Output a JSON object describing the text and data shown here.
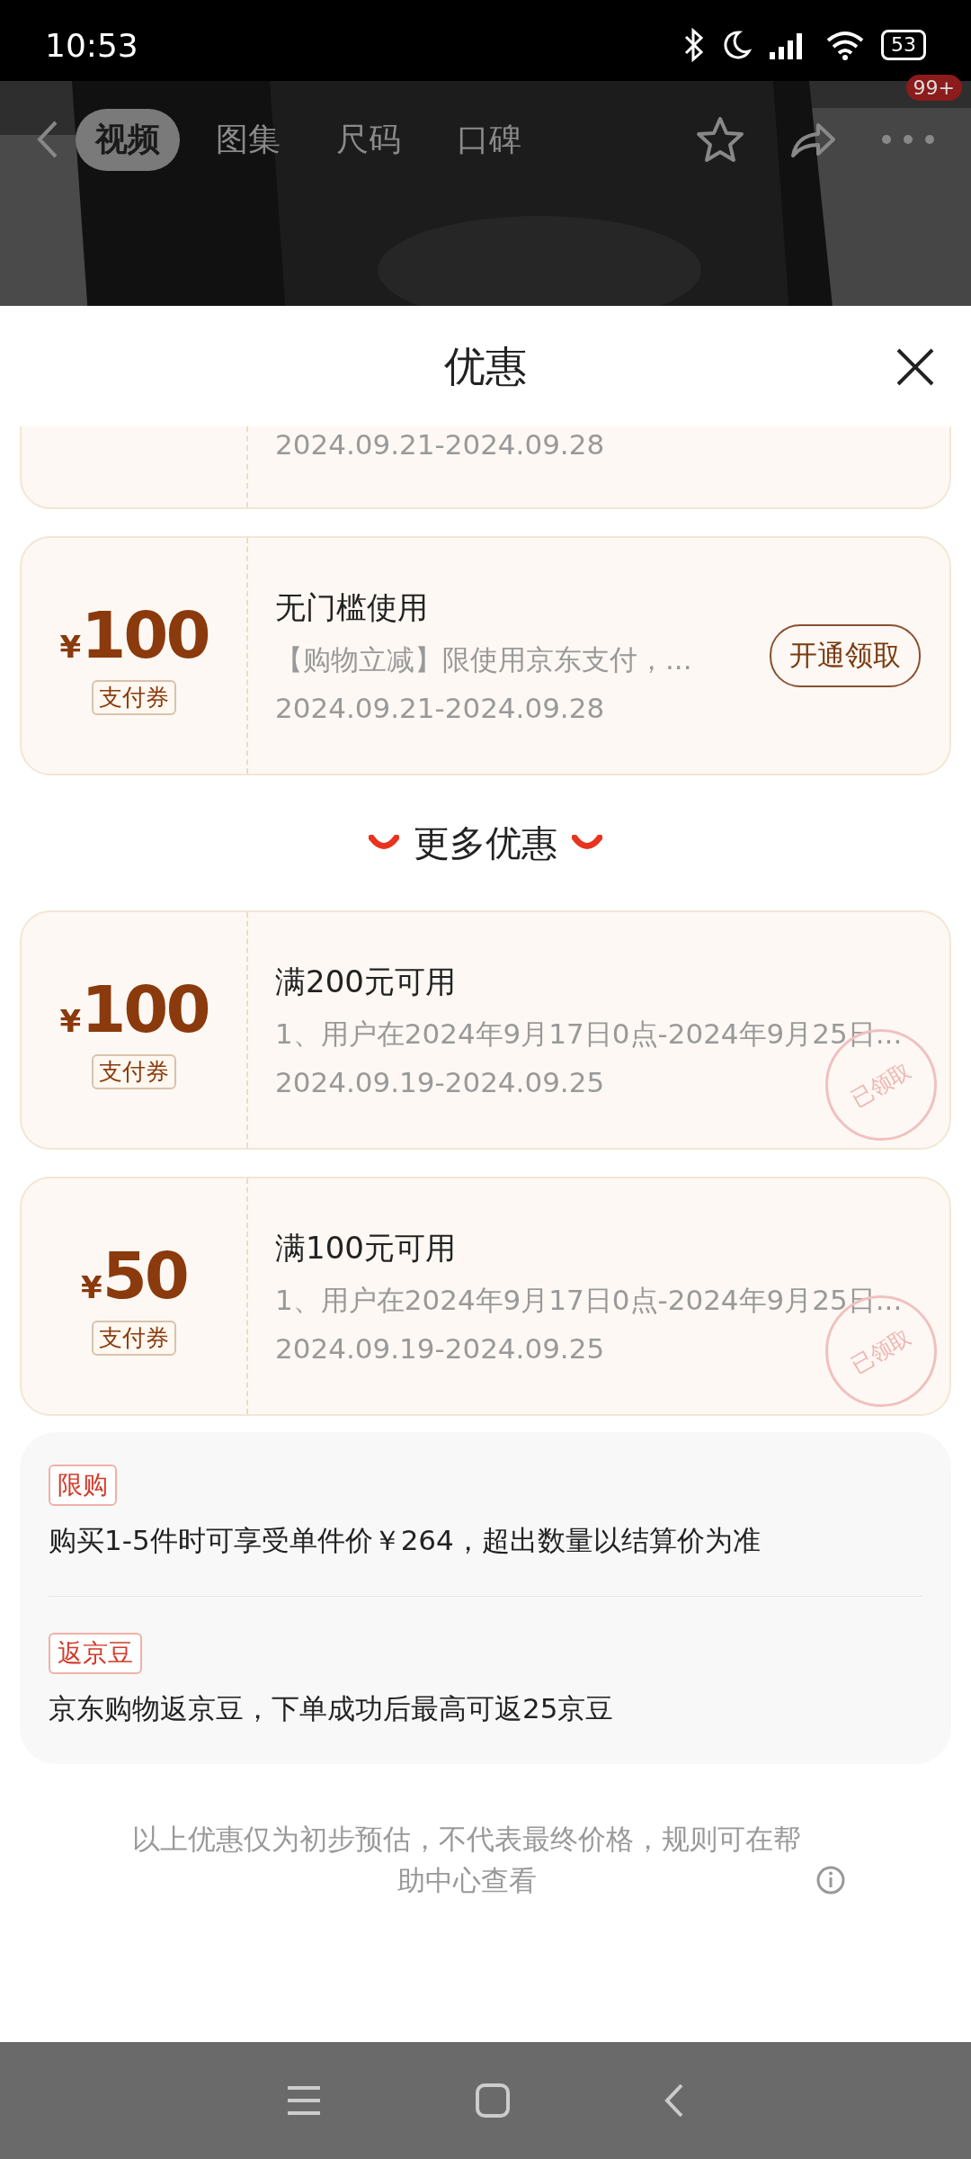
{
  "status_bar": {
    "time": "10:53",
    "battery": "53"
  },
  "nav": {
    "tabs": [
      {
        "label": "视频",
        "selected": true
      },
      {
        "label": "图集",
        "selected": false
      },
      {
        "label": "尺码",
        "selected": false
      },
      {
        "label": "口碑",
        "selected": false
      }
    ],
    "badge": "99+"
  },
  "sheet": {
    "title": "优惠",
    "top_coupon": {
      "date": "2024.09.21-2024.09.28"
    },
    "coupons": [
      {
        "currency": "¥",
        "amount": "100",
        "tag": "支付券",
        "title": "无门槛使用",
        "desc": "【购物立减】限使用京东支付，...",
        "date": "2024.09.21-2024.09.28",
        "action": "开通领取",
        "claimed": false
      }
    ],
    "more": {
      "heading": "更多优惠",
      "coupons": [
        {
          "currency": "¥",
          "amount": "100",
          "tag": "支付券",
          "title": "满200元可用",
          "desc": "1、用户在2024年9月17日0点-2024年9月25日...",
          "date": "2024.09.19-2024.09.25",
          "claimed": true,
          "stamp": "已领取"
        },
        {
          "currency": "¥",
          "amount": "50",
          "tag": "支付券",
          "title": "满100元可用",
          "desc": "1、用户在2024年9月17日0点-2024年9月25日...",
          "date": "2024.09.19-2024.09.25",
          "claimed": true,
          "stamp": "已领取"
        }
      ]
    },
    "info": [
      {
        "tag": "限购",
        "text": "购买1-5件时可享受单件价￥264，超出数量以结算价为准"
      },
      {
        "tag": "返京豆",
        "text": "京东购物返京豆，下单成功后最高可返25京豆"
      }
    ],
    "footer": "以上优惠仅为初步预估，不代表最终价格，规则可在帮助中心查看"
  }
}
